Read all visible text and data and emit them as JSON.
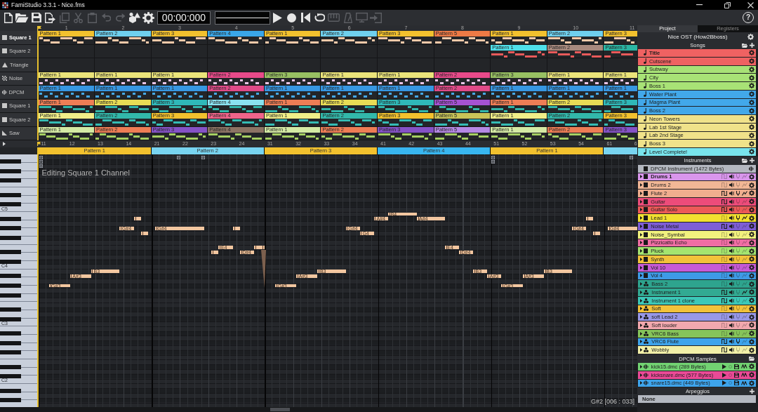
{
  "window": {
    "title": "FamiStudio 3.3.1 - Nice.fms",
    "controls": [
      {
        "kind": "minimize"
      },
      {
        "kind": "restore"
      },
      {
        "kind": "close"
      }
    ]
  },
  "toolbar": {
    "buttons": [
      {
        "kind": "new",
        "disabled": false
      },
      {
        "kind": "open",
        "disabled": false
      },
      {
        "kind": "save",
        "disabled": false
      },
      {
        "kind": "export",
        "disabled": false
      },
      {
        "kind": "copy",
        "disabled": true
      },
      {
        "kind": "cut",
        "disabled": true
      },
      {
        "kind": "paste",
        "disabled": true
      },
      {
        "kind": "undo",
        "disabled": true
      },
      {
        "kind": "redo",
        "disabled": true
      },
      {
        "kind": "transform",
        "disabled": false
      },
      {
        "kind": "settings",
        "disabled": false
      }
    ],
    "timecode": "00:00:000",
    "transport": [
      {
        "kind": "play",
        "disabled": false
      },
      {
        "kind": "record",
        "disabled": false
      },
      {
        "kind": "rewind",
        "disabled": false
      },
      {
        "kind": "loop",
        "disabled": false
      },
      {
        "kind": "keyboard",
        "disabled": true
      },
      {
        "kind": "metronome",
        "disabled": true
      },
      {
        "kind": "monitor",
        "disabled": true
      },
      {
        "kind": "enter",
        "disabled": true
      }
    ],
    "help": "?"
  },
  "sequencer": {
    "bars": [
      "1",
      "2",
      "3",
      "4",
      "5",
      "6",
      "7",
      "8",
      "9",
      "10",
      "11"
    ],
    "channels": [
      {
        "name": "Square 1",
        "kind": "square",
        "selected": true,
        "color": "#f4c9a8",
        "patterns": [
          {
            "name": "Pattern 1",
            "color": "#f2c12e"
          },
          {
            "name": "Pattern 2",
            "color": "#6fd0ee"
          },
          {
            "name": "Pattern 3",
            "color": "#f2c12e"
          },
          {
            "name": "Pattern 4",
            "color": "#3aa6e8"
          },
          {
            "name": "Pattern 1",
            "color": "#f2c12e"
          },
          {
            "name": "Pattern 2",
            "color": "#6fd0ee"
          },
          {
            "name": "Pattern 3",
            "color": "#f2c12e"
          },
          {
            "name": "Pattern 5",
            "color": "#ee7a45"
          },
          {
            "name": "Pattern 1",
            "color": "#f2c12e"
          },
          {
            "name": "Pattern 2",
            "color": "#6fd0ee"
          },
          {
            "name": "Pattern 3",
            "color": "#f2c12e"
          }
        ]
      },
      {
        "name": "Square 2",
        "kind": "square",
        "selected": false,
        "color": "#e85a5a",
        "patterns": [
          {
            "kind": "empty"
          },
          {
            "kind": "empty"
          },
          {
            "kind": "empty"
          },
          {
            "kind": "empty"
          },
          {
            "kind": "empty"
          },
          {
            "kind": "empty"
          },
          {
            "kind": "empty"
          },
          {
            "kind": "empty"
          },
          {
            "kind": "pattern",
            "name": "Pattern 1",
            "color": "#4fe0ea"
          },
          {
            "kind": "pattern",
            "name": "Pattern 2",
            "color": "#a88a7e"
          },
          {
            "kind": "pattern",
            "name": "Pattern 3",
            "color": "#2bb5a3"
          }
        ]
      },
      {
        "name": "Triangle",
        "kind": "triangle",
        "selected": false
      },
      {
        "name": "Noise",
        "kind": "noise",
        "selected": false,
        "color": "#e9c4e6",
        "patterns": [
          {
            "name": "Pattern 1",
            "color": "#ebe47a"
          },
          {
            "name": "Pattern 1",
            "color": "#ebe47a"
          },
          {
            "name": "Pattern 1",
            "color": "#ebe47a"
          },
          {
            "name": "Pattern 2",
            "color": "#e84a8a"
          },
          {
            "name": "Pattern 3",
            "color": "#98c062"
          },
          {
            "name": "Pattern 1",
            "color": "#ebe47a"
          },
          {
            "name": "Pattern 1",
            "color": "#ebe47a"
          },
          {
            "name": "Pattern 2",
            "color": "#e84a8a"
          },
          {
            "name": "Pattern 3",
            "color": "#98c062"
          },
          {
            "name": "Pattern 1",
            "color": "#ebe47a"
          },
          {
            "name": "Pattern 1",
            "color": "#ebe47a"
          }
        ]
      },
      {
        "name": "DPCM",
        "kind": "dpcm",
        "selected": false,
        "color": "#45a8e4",
        "patterns": [
          {
            "name": "Pattern 1",
            "color": "#3797e2"
          },
          {
            "name": "Pattern 1",
            "color": "#3797e2"
          },
          {
            "name": "Pattern 1",
            "color": "#3797e2"
          },
          {
            "name": "Pattern 2",
            "color": "#e04a88"
          },
          {
            "name": "Pattern 1",
            "color": "#3797e2"
          },
          {
            "name": "Pattern 1",
            "color": "#3797e2"
          },
          {
            "name": "Pattern 1",
            "color": "#3797e2"
          },
          {
            "name": "Pattern 2",
            "color": "#e04a88"
          },
          {
            "name": "Pattern 1",
            "color": "#3797e2"
          },
          {
            "name": "Pattern 1",
            "color": "#3797e2"
          },
          {
            "name": "Pattern 1",
            "color": "#3797e2"
          }
        ]
      },
      {
        "name": "Square 1",
        "kind": "square",
        "selected": false,
        "color": "#31b6aa",
        "patterns": [
          {
            "name": "Pattern 1",
            "color": "#ee7d55"
          },
          {
            "name": "Pattern 2",
            "color": "#e8dc55"
          },
          {
            "name": "Pattern 3",
            "color": "#2fb8b8"
          },
          {
            "name": "Pattern 4",
            "color": "#8ae2f0"
          },
          {
            "name": "Pattern 1",
            "color": "#ee7d55"
          },
          {
            "name": "Pattern 2",
            "color": "#e8dc55"
          },
          {
            "name": "Pattern 3",
            "color": "#2fb8b8"
          },
          {
            "name": "Pattern 5",
            "color": "#a552d2"
          },
          {
            "name": "Pattern 1",
            "color": "#ee7d55"
          },
          {
            "name": "Pattern 2",
            "color": "#e8dc55"
          },
          {
            "name": "Pattern 3",
            "color": "#2fb8b8"
          }
        ]
      },
      {
        "name": "Square 2",
        "kind": "square",
        "selected": false,
        "color": "#34bcb4",
        "patterns": [
          {
            "name": "Pattern 1",
            "color": "#f0ee88"
          },
          {
            "name": "Pattern 2",
            "color": "#32b8aa"
          },
          {
            "name": "Pattern 3",
            "color": "#f2c12e"
          },
          {
            "name": "Pattern 4",
            "color": "#f0648a"
          },
          {
            "name": "Pattern 1",
            "color": "#f0ee88"
          },
          {
            "name": "Pattern 2",
            "color": "#32b8aa"
          },
          {
            "name": "Pattern 3",
            "color": "#f2c12e"
          },
          {
            "name": "Pattern 5",
            "color": "#c9c458"
          },
          {
            "name": "Pattern 1",
            "color": "#f0ee88"
          },
          {
            "name": "Pattern 2",
            "color": "#32b8aa"
          },
          {
            "name": "Pattern 3",
            "color": "#f2c12e"
          }
        ]
      },
      {
        "name": "Saw",
        "kind": "saw",
        "selected": false,
        "color": "#a6d062",
        "patterns": [
          {
            "name": "Pattern 1",
            "color": "#d4eaa4"
          },
          {
            "name": "Pattern 2",
            "color": "#ee7d55"
          },
          {
            "name": "Pattern 3",
            "color": "#8552c6"
          },
          {
            "name": "Pattern 4",
            "color": "#8c7464"
          },
          {
            "name": "Pattern 1",
            "color": "#d4eaa4"
          },
          {
            "name": "Pattern 2",
            "color": "#ee7d55"
          },
          {
            "name": "Pattern 3",
            "color": "#8552c6"
          },
          {
            "name": "Pattern 5",
            "color": "#b588e4"
          },
          {
            "name": "Pattern 1",
            "color": "#d4eaa4"
          },
          {
            "name": "Pattern 2",
            "color": "#ee7d55"
          },
          {
            "name": "Pattern 3",
            "color": "#8552c6"
          }
        ]
      }
    ]
  },
  "piano_roll": {
    "beats": [
      "11",
      "12",
      "13",
      "14",
      "21",
      "22",
      "23",
      "24",
      "31",
      "32",
      "33",
      "34",
      "41",
      "42",
      "43",
      "44",
      "51",
      "52",
      "53",
      "54",
      "61",
      "6"
    ],
    "patterns": [
      {
        "name": "Pattern 1",
        "color": "#f2c12e"
      },
      {
        "name": "Pattern 2",
        "color": "#78d4f0"
      },
      {
        "name": "Pattern 3",
        "color": "#f2c12e"
      },
      {
        "name": "Pattern 4",
        "color": "#38b6f0"
      },
      {
        "name": "Pattern 1",
        "color": "#f2c12e"
      },
      {
        "color": "#78d4f0"
      }
    ],
    "caption": "Editing Square 1 Channel",
    "keyboard": {
      "octave_labels": [
        "C5",
        "C4",
        "C3",
        "C2"
      ]
    },
    "effects": [
      {
        "kind": "slide"
      },
      {
        "kind": "slide"
      },
      {
        "kind": "volume"
      },
      {
        "kind": "slide"
      },
      {
        "kind": "slide"
      },
      {
        "kind": "slide"
      },
      {
        "kind": "volume"
      },
      {
        "kind": "slide"
      }
    ],
    "notes": [
      {
        "label": "G#3",
        "selected": false
      },
      {
        "label": "A#3",
        "selected": false
      },
      {
        "label": "B3",
        "selected": false
      },
      {
        "label": "G#4",
        "selected": false
      },
      {
        "selected": false
      },
      {
        "selected": false
      },
      {
        "label": "G#4",
        "selected": false
      },
      {
        "selected": false
      },
      {
        "label": "E4",
        "selected": false
      },
      {
        "selected": false
      },
      {
        "label": "D#4",
        "selected": false
      },
      {
        "selected": false
      },
      {
        "selected": false,
        "slide": true
      },
      {
        "label": "G#3",
        "selected": false
      },
      {
        "label": "A#3",
        "selected": false
      },
      {
        "label": "B3",
        "selected": false
      },
      {
        "label": "G#4",
        "selected": false
      },
      {
        "label": "G4",
        "selected": false
      },
      {
        "label": "A#4",
        "selected": false
      },
      {
        "label": "B4",
        "selected": false
      },
      {
        "label": "A#4",
        "selected": false
      },
      {
        "label": "E4",
        "selected": false
      },
      {
        "label": "D#4",
        "selected": false
      },
      {
        "label": "B3",
        "selected": false
      },
      {
        "label": "A#3",
        "selected": false
      },
      {
        "label": "G#3",
        "selected": false
      },
      {
        "label": "A#3",
        "selected": false
      },
      {
        "label": "B3",
        "selected": false
      },
      {
        "label": "G#4",
        "selected": false
      },
      {
        "selected": false
      },
      {
        "selected": false
      },
      {
        "label": "G#4",
        "selected": false
      }
    ],
    "cursor_info": "G#2 [006 : 033]"
  },
  "panel": {
    "tabs": [
      {
        "label": "Project",
        "selected": true
      },
      {
        "label": "Registers",
        "selected": false
      }
    ],
    "project": "Nice OST (How2Bboss)",
    "songs": {
      "title": "Songs",
      "items": [
        {
          "name": "Title",
          "color": "#ef6262",
          "selected": true
        },
        {
          "name": "Cutscene",
          "color": "#ef6262",
          "selected": false
        },
        {
          "name": "Subway",
          "color": "#a8e276",
          "selected": false
        },
        {
          "name": "City",
          "color": "#a8e276",
          "selected": false
        },
        {
          "name": "Boss 1",
          "color": "#a8e276",
          "selected": false
        },
        {
          "name": "Water Plant",
          "color": "#42a8ea",
          "selected": false
        },
        {
          "name": "Magma Plant",
          "color": "#42a8ea",
          "selected": false
        },
        {
          "name": "Boss 2",
          "color": "#42a8ea",
          "selected": false
        },
        {
          "name": "Neon Towers",
          "color": "#f0e28a",
          "selected": false
        },
        {
          "name": "Lab 1st Stage",
          "color": "#f0e28a",
          "selected": false
        },
        {
          "name": "Lab 2nd Stage",
          "color": "#f0e28a",
          "selected": false
        },
        {
          "name": "Boss 3",
          "color": "#f0e28a",
          "selected": false
        },
        {
          "name": "Level Complete!",
          "color": "#78e4ec",
          "selected": false
        }
      ]
    },
    "instruments": {
      "title": "Instruments",
      "dpcm": "DPCM Instrument (1472 Bytes)",
      "items": [
        {
          "name": "Drums 1",
          "color": "#d996ec",
          "kind": "standard",
          "selected": true,
          "envelopes": {
            "duty": false,
            "volume": true,
            "pitch": false,
            "arpeggio": false
          }
        },
        {
          "name": "Drums 2",
          "color": "#f2b796",
          "kind": "standard",
          "selected": false,
          "envelopes": {
            "duty": false,
            "volume": true,
            "pitch": false,
            "arpeggio": false
          }
        },
        {
          "name": "Flute 2",
          "color": "#f0ae8e",
          "kind": "standard",
          "selected": false,
          "envelopes": {
            "duty": true,
            "volume": true,
            "pitch": true,
            "arpeggio": true
          }
        },
        {
          "name": "Guitar",
          "color": "#ec4c7a",
          "kind": "standard",
          "selected": false,
          "envelopes": {
            "duty": true,
            "volume": true,
            "pitch": false,
            "arpeggio": false
          }
        },
        {
          "name": "Guitar Solo",
          "color": "#ec5a58",
          "kind": "standard",
          "selected": false,
          "envelopes": {
            "duty": true,
            "volume": true,
            "pitch": false,
            "arpeggio": false
          }
        },
        {
          "name": "Lead 1",
          "color": "#f2e030",
          "kind": "standard",
          "selected": false,
          "envelopes": {
            "duty": false,
            "volume": true,
            "pitch": true,
            "arpeggio": true
          }
        },
        {
          "name": "Noise Metal",
          "color": "#7e5ed6",
          "kind": "standard",
          "selected": false,
          "envelopes": {
            "duty": true,
            "volume": true,
            "pitch": false,
            "arpeggio": false
          }
        },
        {
          "name": "Noise_Symbal",
          "color": "#f2f27e",
          "kind": "standard",
          "selected": false,
          "envelopes": {
            "duty": false,
            "volume": true,
            "pitch": false,
            "arpeggio": false
          }
        },
        {
          "name": "Pizzicatto Echo",
          "color": "#f06ea4",
          "kind": "standard",
          "selected": false,
          "envelopes": {
            "duty": false,
            "volume": true,
            "pitch": false,
            "arpeggio": false
          }
        },
        {
          "name": "Pluck",
          "color": "#a4e470",
          "kind": "standard",
          "selected": false,
          "envelopes": {
            "duty": false,
            "volume": true,
            "pitch": false,
            "arpeggio": false
          }
        },
        {
          "name": "Synth",
          "color": "#f2c23a",
          "kind": "standard",
          "selected": false,
          "envelopes": {
            "duty": false,
            "volume": true,
            "pitch": false,
            "arpeggio": false
          }
        },
        {
          "name": "Vol 10",
          "color": "#c65ad6",
          "kind": "standard",
          "selected": false,
          "envelopes": {
            "duty": false,
            "volume": true,
            "pitch": false,
            "arpeggio": false
          }
        },
        {
          "name": "Vol 4",
          "color": "#3e9ae6",
          "kind": "standard",
          "selected": false,
          "envelopes": {
            "duty": false,
            "volume": true,
            "pitch": false,
            "arpeggio": false
          }
        },
        {
          "name": "Bass 2",
          "color": "#2ea48e",
          "kind": "expansion",
          "selected": false,
          "envelopes": {
            "duty": false,
            "volume": true,
            "pitch": false,
            "arpeggio": false
          }
        },
        {
          "name": "Instrument 1",
          "color": "#32aa92",
          "kind": "expansion",
          "selected": false,
          "envelopes": {
            "duty": true,
            "volume": true,
            "pitch": false,
            "arpeggio": true
          }
        },
        {
          "name": "Instrument 1 clone",
          "color": "#3cc8b8",
          "kind": "expansion",
          "selected": false,
          "envelopes": {
            "duty": true,
            "volume": true,
            "pitch": false,
            "arpeggio": false
          }
        },
        {
          "name": "Soft",
          "color": "#f2c23a",
          "kind": "expansion",
          "selected": false,
          "envelopes": {
            "duty": false,
            "volume": true,
            "pitch": false,
            "arpeggio": false
          }
        },
        {
          "name": "soft Lead 2",
          "color": "#9898e8",
          "kind": "expansion",
          "selected": false,
          "envelopes": {
            "duty": false,
            "volume": true,
            "pitch": false,
            "arpeggio": false
          }
        },
        {
          "name": "Soft louder",
          "color": "#f2a8ae",
          "kind": "expansion",
          "selected": false,
          "envelopes": {
            "duty": false,
            "volume": true,
            "pitch": false,
            "arpeggio": false
          }
        },
        {
          "name": "VRC6 Bass",
          "color": "#86c45a",
          "kind": "expansion",
          "selected": false,
          "envelopes": {
            "duty": false,
            "volume": true,
            "pitch": false,
            "arpeggio": false
          }
        },
        {
          "name": "VRC6 Flute",
          "color": "#3ea4ec",
          "kind": "expansion",
          "selected": false,
          "envelopes": {
            "duty": true,
            "volume": true,
            "pitch": true,
            "arpeggio": false
          }
        },
        {
          "name": "Wobbly",
          "color": "#f2f0a8",
          "kind": "expansion",
          "selected": false,
          "envelopes": {
            "duty": true,
            "volume": true,
            "pitch": false,
            "arpeggio": false
          }
        }
      ]
    },
    "samples": {
      "title": "DPCM Samples",
      "items": [
        {
          "name": "kick15.dmc (289 Bytes)",
          "color": "#72d272"
        },
        {
          "name": "kicksnare.dmc (577 Bytes)",
          "color": "#ea4a96"
        },
        {
          "name": "snare15.dmc (449 Bytes)",
          "color": "#3ea4ec"
        }
      ]
    },
    "arpeggios": {
      "title": "Arpeggios",
      "items": [
        {
          "name": "None"
        }
      ]
    }
  }
}
